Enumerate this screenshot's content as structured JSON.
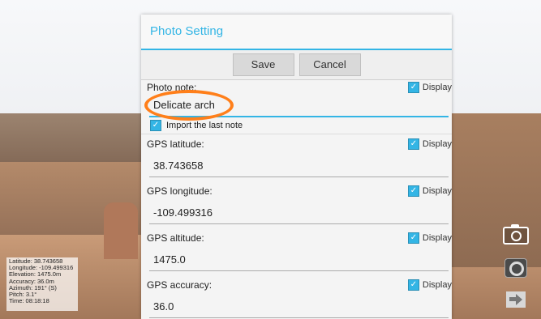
{
  "dialog": {
    "title": "Photo Setting",
    "save_label": "Save",
    "cancel_label": "Cancel",
    "display_label": "Display",
    "photo_note": {
      "label": "Photo note:",
      "value": "Delicate arch"
    },
    "import_last_note": "Import the last note",
    "gps_latitude": {
      "label": "GPS latitude:",
      "value": "38.743658"
    },
    "gps_longitude": {
      "label": "GPS longitude:",
      "value": "-109.499316"
    },
    "gps_altitude": {
      "label": "GPS altitude:",
      "value": "1475.0"
    },
    "gps_accuracy": {
      "label": "GPS accuracy:",
      "value": "36.0"
    }
  },
  "info_overlay": {
    "latitude": "Latitude: 38.743658",
    "longitude": "Longitude: -109.499316",
    "elevation": "Elevation: 1475.0m",
    "accuracy": "Accuracy: 36.0m",
    "azimuth": "Azimuth: 191° (S)",
    "pitch": "Pitch: 3.1°",
    "time": "Time: 08:18:18"
  },
  "icons": {
    "camera": "camera-icon",
    "lens": "lens-icon",
    "exit": "exit-icon",
    "checkbox": "checkbox-checked-icon"
  },
  "colors": {
    "accent": "#33b5e5",
    "highlight_oval": "#ff7f1a"
  }
}
